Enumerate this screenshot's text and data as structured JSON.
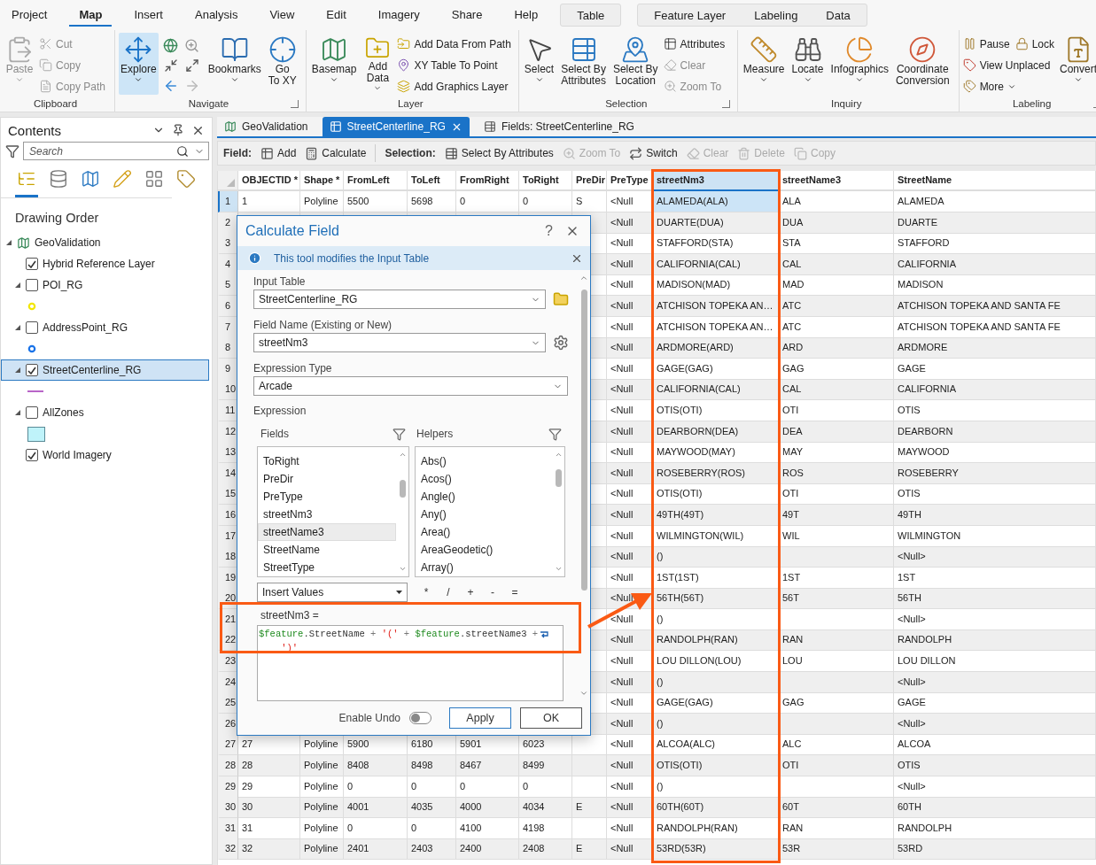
{
  "ribbon": {
    "tabs": [
      {
        "label": "Project",
        "selected": false
      },
      {
        "label": "Map",
        "selected": true
      },
      {
        "label": "Insert",
        "selected": false
      },
      {
        "label": "Analysis",
        "selected": false
      },
      {
        "label": "View",
        "selected": false
      },
      {
        "label": "Edit",
        "selected": false
      },
      {
        "label": "Imagery",
        "selected": false
      },
      {
        "label": "Share",
        "selected": false
      },
      {
        "label": "Help",
        "selected": false
      }
    ],
    "context_tabs": [
      [
        {
          "label": "Table",
          "selected": false
        }
      ],
      [
        {
          "label": "Feature Layer",
          "selected": false
        },
        {
          "label": "Labeling",
          "selected": false
        },
        {
          "label": "Data",
          "selected": false
        }
      ]
    ],
    "groups": [
      {
        "label": "Clipboard",
        "launcher": false,
        "items": [
          {
            "kind": "large",
            "label": "Paste",
            "disabled": true,
            "selected": false,
            "dropdown": true
          },
          {
            "kind": "stack",
            "rows": [
              [
                {
                  "label": "Cut",
                  "disabled": true,
                  "dropdown": false
                }
              ],
              [
                {
                  "label": "Copy",
                  "disabled": true,
                  "dropdown": false
                }
              ],
              [
                {
                  "label": "Copy Path",
                  "disabled": true,
                  "dropdown": false
                }
              ]
            ]
          }
        ]
      },
      {
        "label": "Navigate",
        "launcher": true,
        "items": [
          {
            "kind": "large",
            "label": "Explore",
            "disabled": false,
            "selected": true,
            "dropdown": true
          },
          {
            "kind": "tools"
          },
          {
            "kind": "large",
            "label": "Bookmarks",
            "disabled": false,
            "selected": false,
            "dropdown": true
          },
          {
            "kind": "large",
            "label": "Go\nTo XY",
            "disabled": false,
            "selected": false,
            "dropdown": false
          }
        ]
      },
      {
        "label": "Layer",
        "launcher": false,
        "items": [
          {
            "kind": "large",
            "label": "Basemap",
            "disabled": false,
            "selected": false,
            "dropdown": true
          },
          {
            "kind": "large",
            "label": "Add\nData",
            "disabled": false,
            "selected": false,
            "dropdown": true
          },
          {
            "kind": "stack",
            "rows": [
              [
                {
                  "label": "Add Data From Path",
                  "disabled": false,
                  "dropdown": false
                }
              ],
              [
                {
                  "label": "XY Table To Point",
                  "disabled": false,
                  "dropdown": false
                }
              ],
              [
                {
                  "label": "Add Graphics Layer",
                  "disabled": false,
                  "dropdown": false
                }
              ]
            ]
          }
        ]
      },
      {
        "label": "Selection",
        "launcher": true,
        "items": [
          {
            "kind": "large",
            "label": "Select",
            "disabled": false,
            "selected": false,
            "dropdown": true
          },
          {
            "kind": "large",
            "label": "Select By\nAttributes",
            "disabled": false,
            "selected": false,
            "dropdown": false
          },
          {
            "kind": "large",
            "label": "Select By\nLocation",
            "disabled": false,
            "selected": false,
            "dropdown": false
          },
          {
            "kind": "stack",
            "rows": [
              [
                {
                  "label": "Attributes",
                  "disabled": false,
                  "dropdown": false
                }
              ],
              [
                {
                  "label": "Clear",
                  "disabled": true,
                  "dropdown": false
                }
              ],
              [
                {
                  "label": "Zoom To",
                  "disabled": true,
                  "dropdown": false
                }
              ]
            ]
          }
        ]
      },
      {
        "label": "Inquiry",
        "launcher": false,
        "items": [
          {
            "kind": "large",
            "label": "Measure",
            "disabled": false,
            "selected": false,
            "dropdown": true
          },
          {
            "kind": "large",
            "label": "Locate",
            "disabled": false,
            "selected": false,
            "dropdown": true
          },
          {
            "kind": "large",
            "label": "Infographics",
            "disabled": false,
            "selected": false,
            "dropdown": true
          },
          {
            "kind": "large",
            "label": "Coordinate\nConversion",
            "disabled": false,
            "selected": false,
            "dropdown": false
          }
        ]
      },
      {
        "label": "Labeling",
        "launcher": true,
        "items": [
          {
            "kind": "stack",
            "rows": [
              [
                {
                  "label": "Pause",
                  "disabled": false,
                  "dropdown": false
                },
                {
                  "label": "Lock",
                  "disabled": false,
                  "dropdown": false
                }
              ],
              [
                {
                  "label": "View Unplaced",
                  "disabled": false,
                  "dropdown": false
                }
              ],
              [
                {
                  "label": "More",
                  "disabled": false,
                  "dropdown": true
                }
              ]
            ]
          },
          {
            "kind": "large",
            "label": "Convert",
            "disabled": false,
            "selected": false,
            "dropdown": true
          }
        ]
      }
    ]
  },
  "contents": {
    "title": "Contents",
    "search": {
      "placeholder": "Search"
    },
    "views": [
      {
        "selected": true
      },
      {
        "selected": false
      },
      {
        "selected": false
      },
      {
        "selected": false
      },
      {
        "selected": false
      },
      {
        "selected": false
      }
    ],
    "heading": "Drawing Order",
    "tree": [
      {
        "label": "GeoValidation",
        "expanded": true,
        "children": [
          {
            "label": "Hybrid Reference Layer",
            "checked": true,
            "selected": false
          },
          {
            "label": "POI_RG",
            "checked": false,
            "selected": false,
            "expanded": true,
            "legend": {
              "kind": "point",
              "color": "#f2e600"
            }
          },
          {
            "label": "AddressPoint_RG",
            "checked": false,
            "selected": false,
            "expanded": true,
            "legend": {
              "kind": "point",
              "color": "#1a73e8"
            }
          },
          {
            "label": "StreetCenterline_RG",
            "checked": true,
            "selected": true,
            "expanded": true,
            "legend": {
              "kind": "line",
              "color": "#b865c8"
            }
          },
          {
            "label": "AllZones",
            "checked": false,
            "selected": false,
            "expanded": true,
            "legend": {
              "kind": "polygon",
              "color": "#bff3fa"
            }
          },
          {
            "label": "World Imagery",
            "checked": true,
            "selected": false
          }
        ]
      }
    ]
  },
  "doc_tabs": [
    {
      "label": "GeoValidation",
      "kind": "map",
      "selected": false,
      "closable": false
    },
    {
      "label": "StreetCenterline_RG",
      "kind": "table",
      "selected": true,
      "closable": true
    },
    {
      "label": "Fields: StreetCenterline_RG",
      "kind": "fields",
      "selected": false,
      "closable": false
    }
  ],
  "toolbar": [
    {
      "kind": "label",
      "label": "Field:"
    },
    {
      "kind": "button",
      "label": "Add",
      "disabled": false
    },
    {
      "kind": "button",
      "label": "Calculate",
      "disabled": false
    },
    {
      "kind": "separator"
    },
    {
      "kind": "label",
      "label": "Selection:"
    },
    {
      "kind": "button",
      "label": "Select By Attributes",
      "disabled": false
    },
    {
      "kind": "button",
      "label": "Zoom To",
      "disabled": true
    },
    {
      "kind": "button",
      "label": "Switch",
      "disabled": false
    },
    {
      "kind": "button",
      "label": "Clear",
      "disabled": true
    },
    {
      "kind": "button",
      "label": "Delete",
      "disabled": true
    },
    {
      "kind": "button",
      "label": "Copy",
      "disabled": true
    }
  ],
  "table": {
    "columns": [
      {
        "label": "OBJECTID *",
        "selected": false
      },
      {
        "label": "Shape *",
        "selected": false
      },
      {
        "label": "FromLeft",
        "selected": false
      },
      {
        "label": "ToLeft",
        "selected": false
      },
      {
        "label": "FromRight",
        "selected": false
      },
      {
        "label": "ToRight",
        "selected": false
      },
      {
        "label": "PreDir",
        "selected": false
      },
      {
        "label": "PreType",
        "selected": false
      },
      {
        "label": "streetNm3",
        "selected": true
      },
      {
        "label": "streetName3",
        "selected": false
      },
      {
        "label": "StreetName",
        "selected": false
      }
    ],
    "rows": [
      {
        "label": "1",
        "selected": true,
        "cells": [
          "1",
          "Polyline",
          "5500",
          "5698",
          "0",
          "0",
          "S",
          "<Null",
          "ALAMEDA(ALA)",
          "ALA",
          "ALAMEDA"
        ]
      },
      {
        "label": "2",
        "selected": false,
        "cells": [
          null,
          null,
          null,
          null,
          null,
          null,
          null,
          "<Null",
          "DUARTE(DUA)",
          "DUA",
          "DUARTE"
        ]
      },
      {
        "label": "3",
        "selected": false,
        "cells": [
          null,
          null,
          null,
          null,
          null,
          null,
          null,
          "<Null",
          "STAFFORD(STA)",
          "STA",
          "STAFFORD"
        ]
      },
      {
        "label": "4",
        "selected": false,
        "cells": [
          null,
          null,
          null,
          null,
          null,
          null,
          null,
          "<Null",
          "CALIFORNIA(CAL)",
          "CAL",
          "CALIFORNIA"
        ]
      },
      {
        "label": "5",
        "selected": false,
        "cells": [
          null,
          null,
          null,
          null,
          null,
          null,
          null,
          "<Null",
          "MADISON(MAD)",
          "MAD",
          "MADISON"
        ]
      },
      {
        "label": "6",
        "selected": false,
        "cells": [
          null,
          null,
          null,
          null,
          null,
          null,
          null,
          "<Null",
          "ATCHISON TOPEKA AN…",
          "ATC",
          "ATCHISON TOPEKA AND SANTA FE"
        ]
      },
      {
        "label": "7",
        "selected": false,
        "cells": [
          null,
          null,
          null,
          null,
          null,
          null,
          null,
          "<Null",
          "ATCHISON TOPEKA AN…",
          "ATC",
          "ATCHISON TOPEKA AND SANTA FE"
        ]
      },
      {
        "label": "8",
        "selected": false,
        "cells": [
          null,
          null,
          null,
          null,
          null,
          null,
          null,
          "<Null",
          "ARDMORE(ARD)",
          "ARD",
          "ARDMORE"
        ]
      },
      {
        "label": "9",
        "selected": false,
        "cells": [
          null,
          null,
          null,
          null,
          null,
          null,
          null,
          "<Null",
          "GAGE(GAG)",
          "GAG",
          "GAGE"
        ]
      },
      {
        "label": "10",
        "selected": false,
        "cells": [
          null,
          null,
          null,
          null,
          null,
          null,
          null,
          "<Null",
          "CALIFORNIA(CAL)",
          "CAL",
          "CALIFORNIA"
        ]
      },
      {
        "label": "11",
        "selected": false,
        "cells": [
          null,
          null,
          null,
          null,
          null,
          null,
          null,
          "<Null",
          "OTIS(OTI)",
          "OTI",
          "OTIS"
        ]
      },
      {
        "label": "12",
        "selected": false,
        "cells": [
          null,
          null,
          null,
          null,
          null,
          null,
          null,
          "<Null",
          "DEARBORN(DEA)",
          "DEA",
          "DEARBORN"
        ]
      },
      {
        "label": "13",
        "selected": false,
        "cells": [
          null,
          null,
          null,
          null,
          null,
          null,
          null,
          "<Null",
          "MAYWOOD(MAY)",
          "MAY",
          "MAYWOOD"
        ]
      },
      {
        "label": "14",
        "selected": false,
        "cells": [
          null,
          null,
          null,
          null,
          null,
          null,
          null,
          "<Null",
          "ROSEBERRY(ROS)",
          "ROS",
          "ROSEBERRY"
        ]
      },
      {
        "label": "15",
        "selected": false,
        "cells": [
          null,
          null,
          null,
          null,
          null,
          null,
          null,
          "<Null",
          "OTIS(OTI)",
          "OTI",
          "OTIS"
        ]
      },
      {
        "label": "16",
        "selected": false,
        "cells": [
          null,
          null,
          null,
          null,
          null,
          null,
          null,
          "<Null",
          "49TH(49T)",
          "49T",
          "49TH"
        ]
      },
      {
        "label": "17",
        "selected": false,
        "cells": [
          null,
          null,
          null,
          null,
          null,
          null,
          null,
          "<Null",
          "WILMINGTON(WIL)",
          "WIL",
          "WILMINGTON"
        ]
      },
      {
        "label": "18",
        "selected": false,
        "cells": [
          null,
          null,
          null,
          null,
          null,
          null,
          null,
          "<Null",
          "()",
          null,
          "<Null>"
        ]
      },
      {
        "label": "19",
        "selected": false,
        "cells": [
          null,
          null,
          null,
          null,
          null,
          null,
          null,
          "<Null",
          "1ST(1ST)",
          "1ST",
          "1ST"
        ]
      },
      {
        "label": "20",
        "selected": false,
        "cells": [
          null,
          null,
          null,
          null,
          null,
          null,
          null,
          "<Null",
          "56TH(56T)",
          "56T",
          "56TH"
        ]
      },
      {
        "label": "21",
        "selected": false,
        "cells": [
          null,
          null,
          null,
          null,
          null,
          null,
          null,
          "<Null",
          "()",
          null,
          "<Null>"
        ]
      },
      {
        "label": "22",
        "selected": false,
        "cells": [
          null,
          null,
          null,
          null,
          null,
          null,
          null,
          "<Null",
          "RANDOLPH(RAN)",
          "RAN",
          "RANDOLPH"
        ]
      },
      {
        "label": "23",
        "selected": false,
        "cells": [
          null,
          null,
          null,
          null,
          null,
          null,
          null,
          "<Null",
          "LOU DILLON(LOU)",
          "LOU",
          "LOU DILLON"
        ]
      },
      {
        "label": "24",
        "selected": false,
        "cells": [
          null,
          null,
          null,
          null,
          null,
          null,
          null,
          "<Null",
          "()",
          null,
          "<Null>"
        ]
      },
      {
        "label": "25",
        "selected": false,
        "cells": [
          null,
          null,
          null,
          null,
          null,
          null,
          null,
          "<Null",
          "GAGE(GAG)",
          "GAG",
          "GAGE"
        ]
      },
      {
        "label": "26",
        "selected": false,
        "cells": [
          null,
          null,
          null,
          null,
          null,
          null,
          null,
          "<Null",
          "()",
          null,
          "<Null>"
        ]
      },
      {
        "label": "27",
        "selected": false,
        "cells": [
          "27",
          "Polyline",
          "5900",
          "6180",
          "5901",
          "6023",
          null,
          "<Null",
          "ALCOA(ALC)",
          "ALC",
          "ALCOA"
        ]
      },
      {
        "label": "28",
        "selected": false,
        "cells": [
          "28",
          "Polyline",
          "8408",
          "8498",
          "8467",
          "8499",
          null,
          "<Null",
          "OTIS(OTI)",
          "OTI",
          "OTIS"
        ]
      },
      {
        "label": "29",
        "selected": false,
        "cells": [
          "29",
          "Polyline",
          "0",
          "0",
          "0",
          "0",
          null,
          "<Null",
          "()",
          null,
          "<Null>"
        ]
      },
      {
        "label": "30",
        "selected": false,
        "cells": [
          "30",
          "Polyline",
          "4001",
          "4035",
          "4000",
          "4034",
          "E",
          "<Null",
          "60TH(60T)",
          "60T",
          "60TH"
        ]
      },
      {
        "label": "31",
        "selected": false,
        "cells": [
          "31",
          "Polyline",
          "0",
          "0",
          "4100",
          "4198",
          null,
          "<Null",
          "RANDOLPH(RAN)",
          "RAN",
          "RANDOLPH"
        ]
      },
      {
        "label": "32",
        "selected": false,
        "cells": [
          "32",
          "Polyline",
          "2401",
          "2403",
          "2400",
          "2408",
          "E",
          "<Null",
          "53RD(53R)",
          "53R",
          "53RD"
        ]
      }
    ]
  },
  "dialog": {
    "title": "Calculate Field",
    "help": "?",
    "info": "This tool modifies the Input Table",
    "params": [
      {
        "label": "Input Table",
        "value": "StreetCenterline_RG",
        "kind": "folder"
      },
      {
        "label": "Field Name (Existing or New)",
        "value": "streetNm3",
        "kind": "gear"
      },
      {
        "label": "Expression Type",
        "value": "Arcade",
        "kind": "plain"
      }
    ],
    "expression_label": "Expression",
    "fields": {
      "title": "Fields",
      "items": [
        {
          "label": "ToRight",
          "selected": false
        },
        {
          "label": "PreDir",
          "selected": false
        },
        {
          "label": "PreType",
          "selected": false
        },
        {
          "label": "streetNm3",
          "selected": false
        },
        {
          "label": "streetName3",
          "selected": true
        },
        {
          "label": "StreetName",
          "selected": false
        },
        {
          "label": "StreetType",
          "selected": false
        }
      ]
    },
    "helpers": {
      "title": "Helpers",
      "items": [
        {
          "label": "Abs()",
          "selected": false
        },
        {
          "label": "Acos()",
          "selected": false
        },
        {
          "label": "Angle()",
          "selected": false
        },
        {
          "label": "Any()",
          "selected": false
        },
        {
          "label": "Area()",
          "selected": false
        },
        {
          "label": "AreaGeodetic()",
          "selected": false
        },
        {
          "label": "Array()",
          "selected": false
        }
      ]
    },
    "insert": "Insert Values",
    "operators": [
      "*",
      "/",
      "+",
      "-",
      "="
    ],
    "target": "streetNm3 =",
    "code": [
      {
        "kind": "var",
        "text": "$feature"
      },
      {
        "kind": "prop",
        "text": ".StreetName"
      },
      {
        "kind": "op",
        "text": " + "
      },
      {
        "kind": "string",
        "text": "'('"
      },
      {
        "kind": "op",
        "text": " + "
      },
      {
        "kind": "var",
        "text": "$feature"
      },
      {
        "kind": "prop",
        "text": ".streetName3"
      },
      {
        "kind": "op",
        "text": " +"
      },
      {
        "kind": "wrap"
      },
      {
        "kind": "string",
        "text": "')'"
      }
    ],
    "enable_undo": {
      "label": "Enable Undo",
      "on": false
    },
    "buttons": [
      "Apply",
      "OK"
    ]
  }
}
